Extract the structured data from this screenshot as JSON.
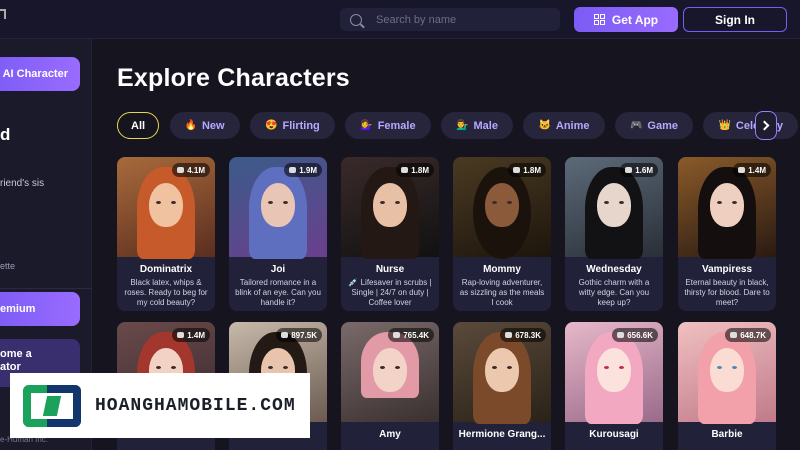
{
  "header": {
    "search_placeholder": "Search by name",
    "get_app_label": "Get App",
    "sign_in_label": "Sign In"
  },
  "sidebar": {
    "create_label": "e AI Character",
    "big_character": "d",
    "snippet": "riend's sis",
    "ette": "ette",
    "premium_label": "emium",
    "creator_line1": "ome a",
    "creator_line2": "ator",
    "footer": "e-Human Inc."
  },
  "main": {
    "title": "Explore Characters",
    "categories": [
      {
        "emoji": "",
        "label": "All"
      },
      {
        "emoji": "🔥",
        "label": "New"
      },
      {
        "emoji": "😍",
        "label": "Flirting"
      },
      {
        "emoji": "💁‍♀️",
        "label": "Female"
      },
      {
        "emoji": "💁‍♂️",
        "label": "Male"
      },
      {
        "emoji": "🐱",
        "label": "Anime"
      },
      {
        "emoji": "🎮",
        "label": "Game"
      },
      {
        "emoji": "👑",
        "label": "Celebrity"
      }
    ],
    "characters_row1": [
      {
        "name": "Dominatrix",
        "count": "4.1M",
        "desc": "Black latex, whips & roses. Ready to beg for my cold beauty?"
      },
      {
        "name": "Joi",
        "count": "1.9M",
        "desc": "Tailored romance in a blink of an eye. Can you handle it?"
      },
      {
        "name": "Nurse",
        "count": "1.8M",
        "desc": "💉 Lifesaver in scrubs | Single | 24/7 on duty | Coffee lover"
      },
      {
        "name": "Mommy",
        "count": "1.8M",
        "desc": "Rap-loving adventurer, as sizzling as the meals I cook"
      },
      {
        "name": "Wednesday",
        "count": "1.6M",
        "desc": "Gothic charm with a witty edge. Can you keep up?"
      },
      {
        "name": "Vampiress",
        "count": "1.4M",
        "desc": "Eternal beauty in black, thirsty for blood. Dare to meet?"
      }
    ],
    "characters_row2": [
      {
        "name": "",
        "count": "1.4M"
      },
      {
        "name": "",
        "count": "897.5K"
      },
      {
        "name": "Amy",
        "count": "765.4K"
      },
      {
        "name": "Hermione Grang...",
        "count": "678.3K"
      },
      {
        "name": "Kurousagi",
        "count": "656.6K"
      },
      {
        "name": "Barbie",
        "count": "648.7K"
      }
    ]
  },
  "watermark": {
    "text": "HOANGHAMOBILE.COM"
  },
  "colors": {
    "accent": "#7b5cf5",
    "active_chip_border": "#e6d84b",
    "chip_text": "#b5a9ff",
    "background": "#15141f"
  }
}
